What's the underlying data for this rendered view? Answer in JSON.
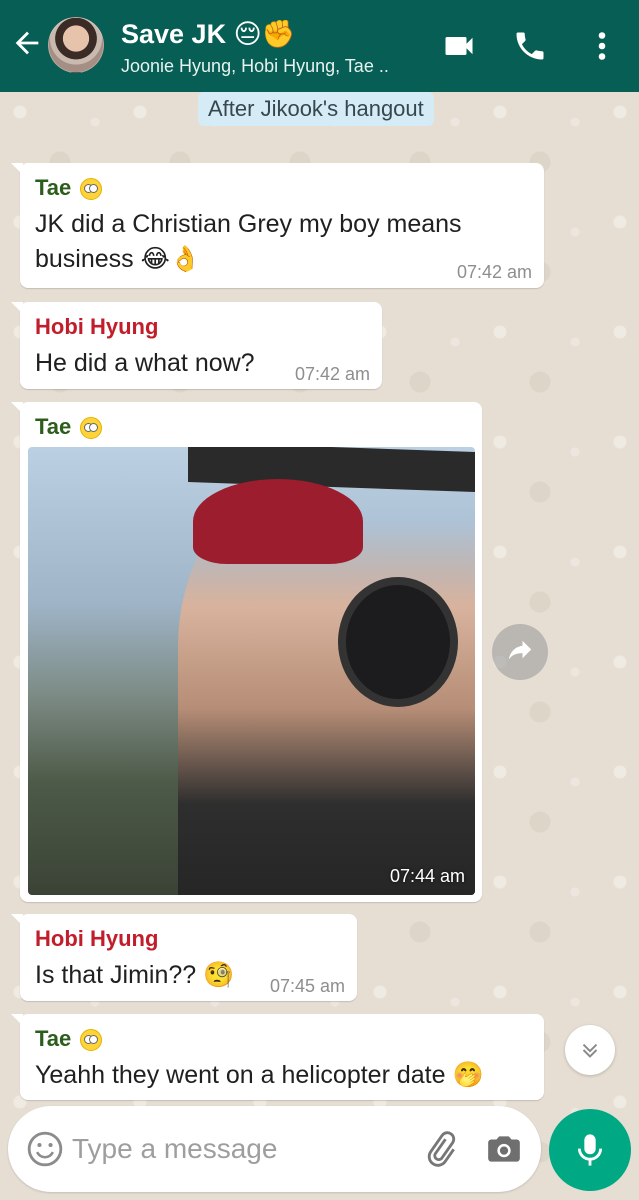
{
  "header": {
    "title": "Save JK 😔✊",
    "subtitle": "Joonie Hyung, Hobi Hyung, Tae ..",
    "color": "#075e54",
    "icons": [
      "back-arrow-icon",
      "video-call-icon",
      "phone-icon",
      "more-vert-icon"
    ]
  },
  "date_chip": "After Jikook's hangout",
  "messages": [
    {
      "sender": "Tae",
      "sender_emoji": "🙄",
      "text_line1": "JK did a Christian Grey my boy means",
      "text_line2": "business",
      "text_emoji": "😂👌",
      "time": "07:42 am"
    },
    {
      "sender": "Hobi Hyung",
      "text": "He did a what now?",
      "time": "07:42 am"
    },
    {
      "sender": "Tae",
      "sender_emoji": "🙄",
      "type": "image",
      "time": "07:44 am"
    },
    {
      "sender": "Hobi Hyung",
      "text": "Is that Jimin??",
      "text_emoji": "🧐",
      "time": "07:45 am"
    },
    {
      "sender": "Tae",
      "sender_emoji": "🙄",
      "text": "Yeahh they went on a helicopter date",
      "text_emoji": "🤭"
    }
  ],
  "input": {
    "placeholder": "Type a message",
    "value": ""
  },
  "colors": {
    "tae_name": "#2d5d1c",
    "hobi_name": "#c21d2a",
    "mic_button": "#00a884",
    "date_chip_bg": "#d5ecf6"
  }
}
